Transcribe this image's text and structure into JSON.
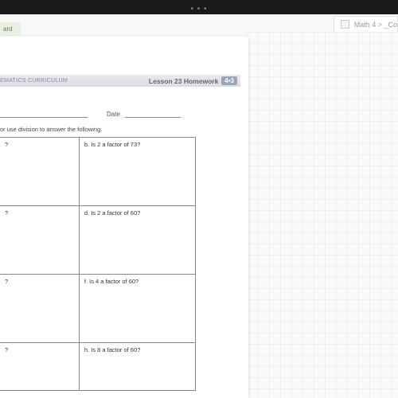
{
  "top": {
    "dots": "• • •",
    "chip": "ard"
  },
  "breadcrumb": {
    "text": "Math 4 > _Co"
  },
  "header": {
    "curriculum": "EMATICS CURRICULUM",
    "lesson": "Lesson 23 Homework",
    "module": "4•3"
  },
  "date_label": "Date",
  "instruction": "or use division to answer the following.",
  "cells": {
    "a": "?",
    "b": "b.   Is 2 a factor of 73?",
    "c": "?",
    "d": "d.   Is 2 a factor of 60?",
    "e": "?",
    "f": "f.   Is 4 a factor of 60?",
    "g": "?",
    "h": "h.   Is 8 a factor of 60?"
  }
}
